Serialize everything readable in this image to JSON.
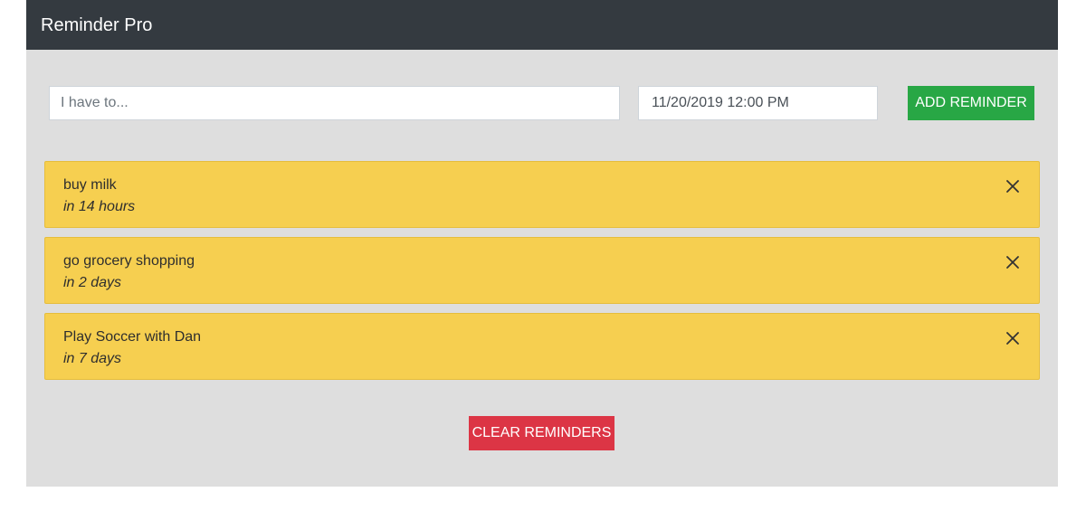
{
  "navbar": {
    "brand": "Reminder Pro",
    "bg_color": "#343a40"
  },
  "form": {
    "text_placeholder": "I have to...",
    "text_value": "",
    "date_value": "11/20/2019 12:00 PM",
    "add_label": "ADD REMINDER",
    "add_color": "#28a745"
  },
  "reminders": [
    {
      "text": "buy milk",
      "due": "in 14 hours",
      "close_icon": "close-icon"
    },
    {
      "text": "go grocery shopping",
      "due": "in 2 days",
      "close_icon": "close-icon"
    },
    {
      "text": "Play Soccer with Dan",
      "due": "in 7 days",
      "close_icon": "close-icon"
    }
  ],
  "reminder_color": "#f6cf50",
  "clear": {
    "label": "CLEAR REMINDERS",
    "color": "#dc3545"
  }
}
